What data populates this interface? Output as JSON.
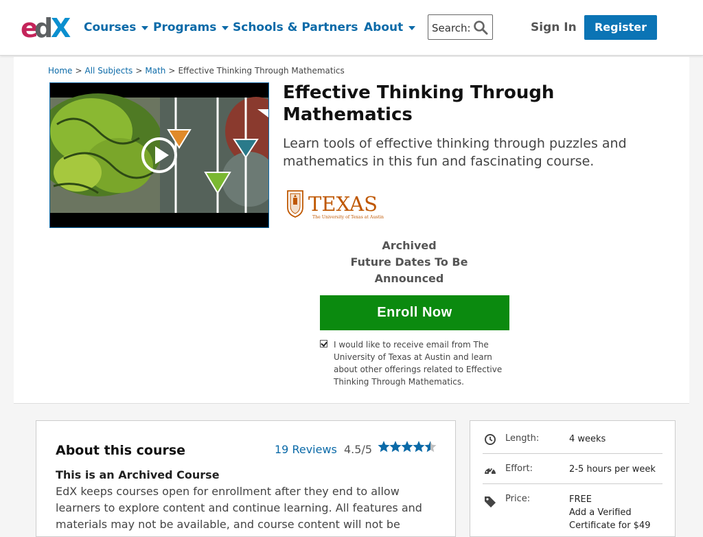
{
  "header": {
    "logo_text": "edX",
    "nav": [
      {
        "label": "Courses",
        "has_dropdown": true
      },
      {
        "label": "Programs",
        "has_dropdown": true
      },
      {
        "label": "Schools & Partners",
        "has_dropdown": false
      },
      {
        "label": "About",
        "has_dropdown": true
      }
    ],
    "search_label": "Search:",
    "search_icon": "search-icon",
    "sign_in": "Sign In",
    "register": "Register"
  },
  "breadcrumb": {
    "items": [
      "Home",
      "All Subjects",
      "Math"
    ],
    "separator": ">",
    "current": "Effective Thinking Through Mathematics"
  },
  "course": {
    "title": "Effective Thinking Through Mathematics",
    "subtitle": "Learn tools of effective thinking through puzzles and mathematics in this fun and fascinating course.",
    "school_logo_text": "TEXAS",
    "school_logo_subtext": "The University of Texas at Austin",
    "status_line1": "Archived",
    "status_line2": "Future Dates To Be Announced",
    "enroll_label": "Enroll Now",
    "optin_checked": true,
    "optin_text": "I would like to receive email from The University of Texas at Austin and learn about other offerings related to Effective Thinking Through Mathematics."
  },
  "about": {
    "heading": "About this course",
    "reviews_link": "19 Reviews",
    "rating": "4.5/5",
    "stars": 4.5,
    "archived_heading": "This is an Archived Course",
    "archived_text": "EdX keeps courses open for enrollment after they end to allow learners to explore content and continue learning. All features and materials may not be available, and course content will not be"
  },
  "details": [
    {
      "icon": "clock-icon",
      "label": "Length:",
      "value": "4 weeks"
    },
    {
      "icon": "dashboard-icon",
      "label": "Effort:",
      "value": "2-5 hours per week"
    },
    {
      "icon": "tag-icon",
      "label": "Price:",
      "value": "FREE",
      "value_extra": "Add a Verified Certificate for $49"
    }
  ],
  "colors": {
    "link_blue": "#0b6aa8",
    "register_blue": "#0b74b5",
    "enroll_green": "#0b8a0f",
    "texas_orange": "#bf5700",
    "star_blue": "#0b6aa8"
  }
}
